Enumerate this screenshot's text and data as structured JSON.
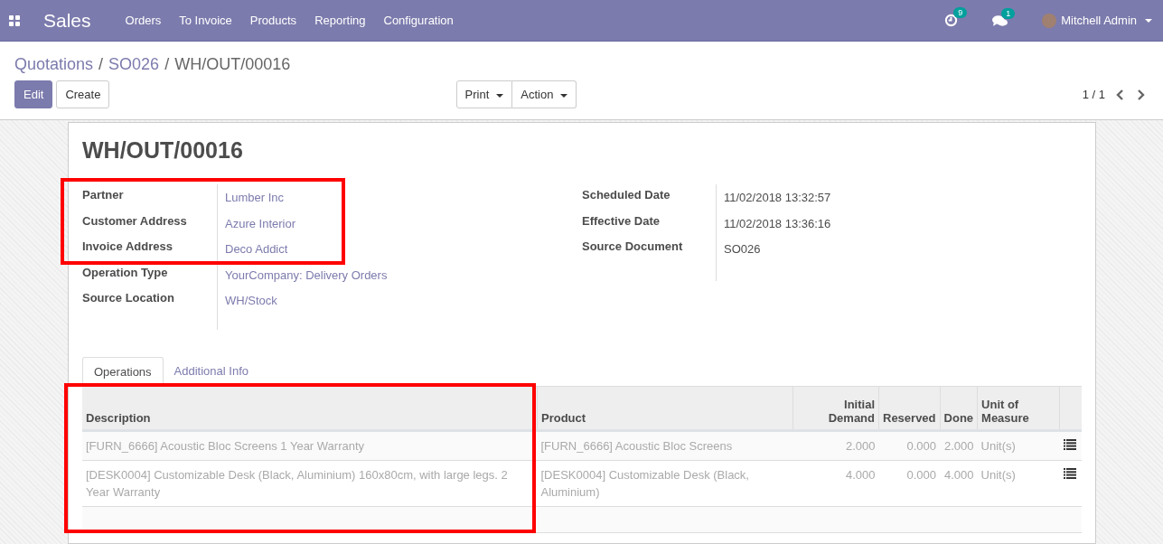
{
  "navbar": {
    "app": "Sales",
    "menu": [
      "Orders",
      "To Invoice",
      "Products",
      "Reporting",
      "Configuration"
    ],
    "activity_count": "9",
    "message_count": "1",
    "user": "Mitchell Admin"
  },
  "breadcrumbs": [
    "Quotations",
    "SO026",
    "WH/OUT/00016"
  ],
  "breadcrumb_separator": "/",
  "buttons": {
    "edit": "Edit",
    "create": "Create",
    "print": "Print",
    "action": "Action"
  },
  "pager": "1 / 1",
  "title": "WH/OUT/00016",
  "left_fields": [
    {
      "label": "Partner",
      "value": "Lumber Inc"
    },
    {
      "label": "Customer Address",
      "value": "Azure Interior"
    },
    {
      "label": "Invoice Address",
      "value": "Deco Addict"
    },
    {
      "label": "Operation Type",
      "value": "YourCompany: Delivery Orders"
    },
    {
      "label": "Source Location",
      "value": "WH/Stock"
    }
  ],
  "right_fields": [
    {
      "label": "Scheduled Date",
      "value": "11/02/2018 13:32:57"
    },
    {
      "label": "Effective Date",
      "value": "11/02/2018 13:36:16"
    },
    {
      "label": "Source Document",
      "value": "SO026"
    }
  ],
  "tabs": [
    {
      "label": "Operations",
      "selected": true
    },
    {
      "label": "Additional Info",
      "selected": false
    }
  ],
  "table": {
    "columns": [
      "Description",
      "Product",
      "Initial Demand",
      "Reserved",
      "Done",
      "Unit of Measure"
    ],
    "rows": [
      {
        "description": "[FURN_6666] Acoustic Bloc Screens 1 Year Warranty",
        "product": "[FURN_6666] Acoustic Bloc Screens",
        "initial_demand": "2.000",
        "reserved": "0.000",
        "done": "2.000",
        "uom": "Unit(s)"
      },
      {
        "description": "[DESK0004] Customizable Desk (Black, Aluminium) 160x80cm, with large legs. 2 Year Warranty",
        "product": "[DESK0004] Customizable Desk (Black, Aluminium)",
        "initial_demand": "4.000",
        "reserved": "0.000",
        "done": "4.000",
        "uom": "Unit(s)"
      }
    ]
  }
}
